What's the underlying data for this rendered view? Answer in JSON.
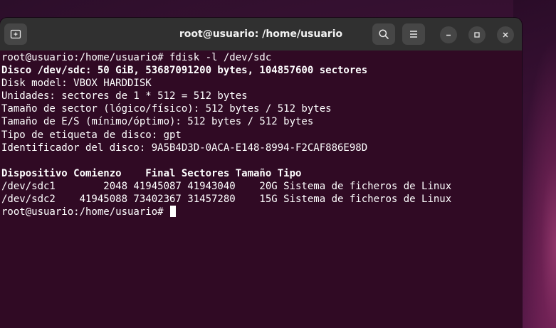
{
  "window": {
    "title": "root@usuario: /home/usuario"
  },
  "icons": {
    "new_tab": "new-tab-icon",
    "search": "search-icon",
    "menu": "hamburger-menu-icon",
    "minimize": "minimize-icon",
    "maximize": "maximize-icon",
    "close": "close-icon"
  },
  "colors": {
    "terminal_bg": "#300a24",
    "titlebar_bg": "#303030",
    "text": "#ffffff"
  },
  "terminal": {
    "lines": [
      {
        "text": "root@usuario:/home/usuario# fdisk -l /dev/sdc",
        "bold": false
      },
      {
        "text": "Disco /dev/sdc: 50 GiB, 53687091200 bytes, 104857600 sectores",
        "bold": true
      },
      {
        "text": "Disk model: VBOX HARDDISK",
        "bold": false
      },
      {
        "text": "Unidades: sectores de 1 * 512 = 512 bytes",
        "bold": false
      },
      {
        "text": "Tamaño de sector (lógico/físico): 512 bytes / 512 bytes",
        "bold": false
      },
      {
        "text": "Tamaño de E/S (mínimo/óptimo): 512 bytes / 512 bytes",
        "bold": false
      },
      {
        "text": "Tipo de etiqueta de disco: gpt",
        "bold": false
      },
      {
        "text": "Identificador del disco: 9A5B4D3D-0ACA-E148-8994-F2CAF886E98D",
        "bold": false
      },
      {
        "text": "",
        "bold": false
      },
      {
        "text": "Dispositivo Comienzo    Final Sectores Tamaño Tipo",
        "bold": true
      },
      {
        "text": "/dev/sdc1        2048 41945087 41943040    20G Sistema de ficheros de Linux",
        "bold": false
      },
      {
        "text": "/dev/sdc2    41945088 73402367 31457280    15G Sistema de ficheros de Linux",
        "bold": false
      }
    ],
    "prompt": "root@usuario:/home/usuario# "
  }
}
